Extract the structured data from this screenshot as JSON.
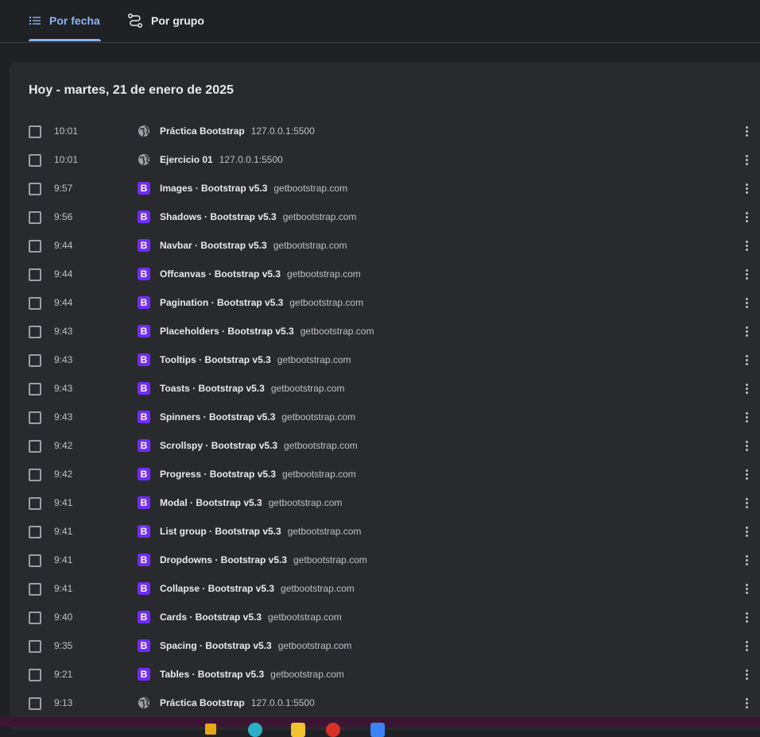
{
  "tabs": [
    {
      "label": "Por fecha",
      "icon": "list-icon",
      "active": true
    },
    {
      "label": "Por grupo",
      "icon": "route-icon",
      "active": false
    }
  ],
  "day": {
    "title": "Hoy - martes, 21 de enero de 2025"
  },
  "colors": {
    "accent": "#8ab4f8",
    "bootstrap": "#712cf9",
    "card": "#292a2d",
    "page": "#202124",
    "taskbar": "#3b1533"
  },
  "entries": [
    {
      "time": "10:01",
      "icon": "globe-icon",
      "title": "Práctica Bootstrap",
      "domain": "127.0.0.1:5500"
    },
    {
      "time": "10:01",
      "icon": "globe-icon",
      "title": "Ejercicio 01",
      "domain": "127.0.0.1:5500"
    },
    {
      "time": "9:57",
      "icon": "bootstrap-icon",
      "title": "Images · Bootstrap v5.3",
      "domain": "getbootstrap.com"
    },
    {
      "time": "9:56",
      "icon": "bootstrap-icon",
      "title": "Shadows · Bootstrap v5.3",
      "domain": "getbootstrap.com"
    },
    {
      "time": "9:44",
      "icon": "bootstrap-icon",
      "title": "Navbar · Bootstrap v5.3",
      "domain": "getbootstrap.com"
    },
    {
      "time": "9:44",
      "icon": "bootstrap-icon",
      "title": "Offcanvas · Bootstrap v5.3",
      "domain": "getbootstrap.com"
    },
    {
      "time": "9:44",
      "icon": "bootstrap-icon",
      "title": "Pagination · Bootstrap v5.3",
      "domain": "getbootstrap.com"
    },
    {
      "time": "9:43",
      "icon": "bootstrap-icon",
      "title": "Placeholders · Bootstrap v5.3",
      "domain": "getbootstrap.com"
    },
    {
      "time": "9:43",
      "icon": "bootstrap-icon",
      "title": "Tooltips · Bootstrap v5.3",
      "domain": "getbootstrap.com"
    },
    {
      "time": "9:43",
      "icon": "bootstrap-icon",
      "title": "Toasts · Bootstrap v5.3",
      "domain": "getbootstrap.com"
    },
    {
      "time": "9:43",
      "icon": "bootstrap-icon",
      "title": "Spinners · Bootstrap v5.3",
      "domain": "getbootstrap.com"
    },
    {
      "time": "9:42",
      "icon": "bootstrap-icon",
      "title": "Scrollspy · Bootstrap v5.3",
      "domain": "getbootstrap.com"
    },
    {
      "time": "9:42",
      "icon": "bootstrap-icon",
      "title": "Progress · Bootstrap v5.3",
      "domain": "getbootstrap.com"
    },
    {
      "time": "9:41",
      "icon": "bootstrap-icon",
      "title": "Modal · Bootstrap v5.3",
      "domain": "getbootstrap.com"
    },
    {
      "time": "9:41",
      "icon": "bootstrap-icon",
      "title": "List group · Bootstrap v5.3",
      "domain": "getbootstrap.com"
    },
    {
      "time": "9:41",
      "icon": "bootstrap-icon",
      "title": "Dropdowns · Bootstrap v5.3",
      "domain": "getbootstrap.com"
    },
    {
      "time": "9:41",
      "icon": "bootstrap-icon",
      "title": "Collapse · Bootstrap v5.3",
      "domain": "getbootstrap.com"
    },
    {
      "time": "9:40",
      "icon": "bootstrap-icon",
      "title": "Cards · Bootstrap v5.3",
      "domain": "getbootstrap.com"
    },
    {
      "time": "9:35",
      "icon": "bootstrap-icon",
      "title": "Spacing · Bootstrap v5.3",
      "domain": "getbootstrap.com"
    },
    {
      "time": "9:21",
      "icon": "bootstrap-icon",
      "title": "Tables · Bootstrap v5.3",
      "domain": "getbootstrap.com"
    },
    {
      "time": "9:13",
      "icon": "globe-icon",
      "title": "Práctica Bootstrap",
      "domain": "127.0.0.1:5500"
    }
  ]
}
